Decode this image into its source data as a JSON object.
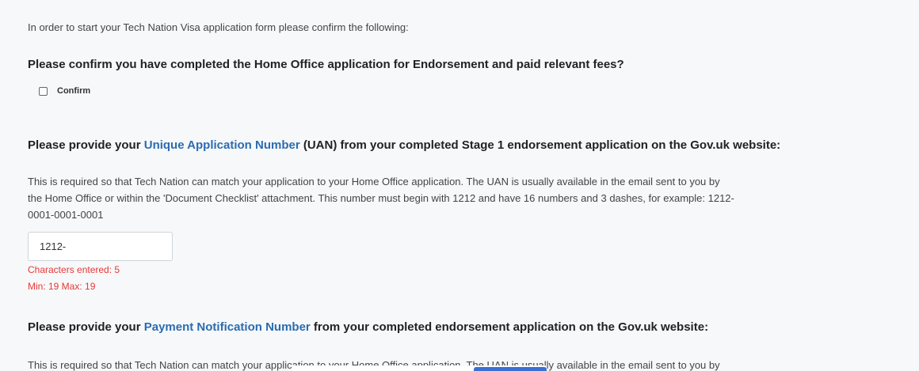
{
  "intro": "In order to start your Tech Nation Visa application form please confirm the following:",
  "question1": "Please confirm you have completed the Home Office application for Endorsement and paid relevant fees?",
  "confirm_label": "Confirm",
  "question2": {
    "before": "Please provide your ",
    "link": "Unique Application Number",
    "after": " (UAN) from your completed Stage 1 endorsement application on the Gov.uk website:"
  },
  "help1": {
    "line1": "This is required so that Tech Nation can match your application to your Home Office application. The UAN is usually available in the email sent to you by",
    "line2": "the Home Office or within the 'Document Checklist' attachment. This number must begin with 1212 and have 16 numbers and 3 dashes, for example: 1212-",
    "line3": "0001-0001-0001"
  },
  "uan_input": {
    "value": "1212-"
  },
  "validation": {
    "chars": "Characters entered: 5",
    "minmax": "Min: 19 Max: 19"
  },
  "question3": {
    "before": "Please provide your ",
    "link": "Payment Notification Number",
    "after": " from your completed endorsement application on the Gov.uk website:"
  },
  "help2": {
    "line1": "This is required so that Tech Nation can match your application to your Home Office application. The UAN is usually available in the email sent to you by"
  },
  "colors": {
    "link": "#2b6cb0",
    "error": "#e53935",
    "background": "#f7f8fa"
  }
}
